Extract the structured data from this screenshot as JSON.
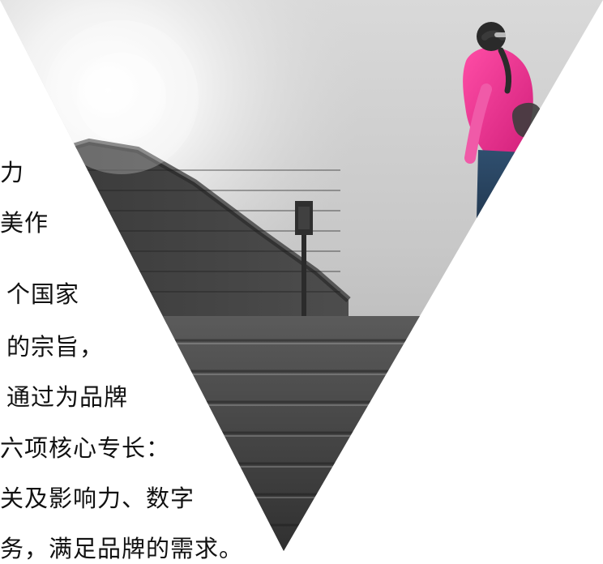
{
  "text_lines": [
    "力",
    "美作",
    "个国家",
    "的宗旨，",
    "通过为品牌",
    "六项核心专长：",
    "关及影响力、数字",
    "务，满足品牌的需求。"
  ]
}
